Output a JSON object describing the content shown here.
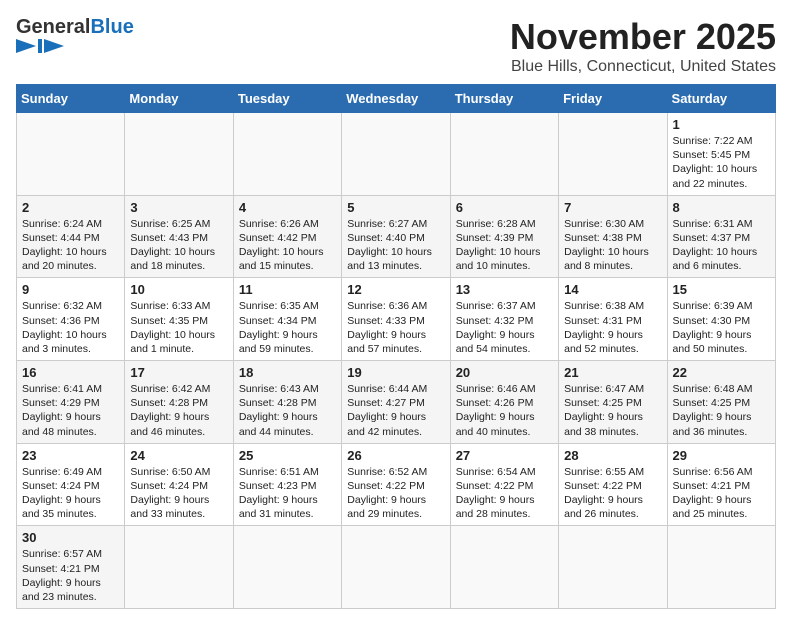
{
  "header": {
    "logo_general": "General",
    "logo_blue": "Blue",
    "month_year": "November 2025",
    "location": "Blue Hills, Connecticut, United States"
  },
  "days_of_week": [
    "Sunday",
    "Monday",
    "Tuesday",
    "Wednesday",
    "Thursday",
    "Friday",
    "Saturday"
  ],
  "weeks": [
    [
      {
        "day": "",
        "info": ""
      },
      {
        "day": "",
        "info": ""
      },
      {
        "day": "",
        "info": ""
      },
      {
        "day": "",
        "info": ""
      },
      {
        "day": "",
        "info": ""
      },
      {
        "day": "",
        "info": ""
      },
      {
        "day": "1",
        "info": "Sunrise: 7:22 AM\nSunset: 5:45 PM\nDaylight: 10 hours and 22 minutes."
      }
    ],
    [
      {
        "day": "2",
        "info": "Sunrise: 6:24 AM\nSunset: 4:44 PM\nDaylight: 10 hours and 20 minutes."
      },
      {
        "day": "3",
        "info": "Sunrise: 6:25 AM\nSunset: 4:43 PM\nDaylight: 10 hours and 18 minutes."
      },
      {
        "day": "4",
        "info": "Sunrise: 6:26 AM\nSunset: 4:42 PM\nDaylight: 10 hours and 15 minutes."
      },
      {
        "day": "5",
        "info": "Sunrise: 6:27 AM\nSunset: 4:40 PM\nDaylight: 10 hours and 13 minutes."
      },
      {
        "day": "6",
        "info": "Sunrise: 6:28 AM\nSunset: 4:39 PM\nDaylight: 10 hours and 10 minutes."
      },
      {
        "day": "7",
        "info": "Sunrise: 6:30 AM\nSunset: 4:38 PM\nDaylight: 10 hours and 8 minutes."
      },
      {
        "day": "8",
        "info": "Sunrise: 6:31 AM\nSunset: 4:37 PM\nDaylight: 10 hours and 6 minutes."
      }
    ],
    [
      {
        "day": "9",
        "info": "Sunrise: 6:32 AM\nSunset: 4:36 PM\nDaylight: 10 hours and 3 minutes."
      },
      {
        "day": "10",
        "info": "Sunrise: 6:33 AM\nSunset: 4:35 PM\nDaylight: 10 hours and 1 minute."
      },
      {
        "day": "11",
        "info": "Sunrise: 6:35 AM\nSunset: 4:34 PM\nDaylight: 9 hours and 59 minutes."
      },
      {
        "day": "12",
        "info": "Sunrise: 6:36 AM\nSunset: 4:33 PM\nDaylight: 9 hours and 57 minutes."
      },
      {
        "day": "13",
        "info": "Sunrise: 6:37 AM\nSunset: 4:32 PM\nDaylight: 9 hours and 54 minutes."
      },
      {
        "day": "14",
        "info": "Sunrise: 6:38 AM\nSunset: 4:31 PM\nDaylight: 9 hours and 52 minutes."
      },
      {
        "day": "15",
        "info": "Sunrise: 6:39 AM\nSunset: 4:30 PM\nDaylight: 9 hours and 50 minutes."
      }
    ],
    [
      {
        "day": "16",
        "info": "Sunrise: 6:41 AM\nSunset: 4:29 PM\nDaylight: 9 hours and 48 minutes."
      },
      {
        "day": "17",
        "info": "Sunrise: 6:42 AM\nSunset: 4:28 PM\nDaylight: 9 hours and 46 minutes."
      },
      {
        "day": "18",
        "info": "Sunrise: 6:43 AM\nSunset: 4:28 PM\nDaylight: 9 hours and 44 minutes."
      },
      {
        "day": "19",
        "info": "Sunrise: 6:44 AM\nSunset: 4:27 PM\nDaylight: 9 hours and 42 minutes."
      },
      {
        "day": "20",
        "info": "Sunrise: 6:46 AM\nSunset: 4:26 PM\nDaylight: 9 hours and 40 minutes."
      },
      {
        "day": "21",
        "info": "Sunrise: 6:47 AM\nSunset: 4:25 PM\nDaylight: 9 hours and 38 minutes."
      },
      {
        "day": "22",
        "info": "Sunrise: 6:48 AM\nSunset: 4:25 PM\nDaylight: 9 hours and 36 minutes."
      }
    ],
    [
      {
        "day": "23",
        "info": "Sunrise: 6:49 AM\nSunset: 4:24 PM\nDaylight: 9 hours and 35 minutes."
      },
      {
        "day": "24",
        "info": "Sunrise: 6:50 AM\nSunset: 4:24 PM\nDaylight: 9 hours and 33 minutes."
      },
      {
        "day": "25",
        "info": "Sunrise: 6:51 AM\nSunset: 4:23 PM\nDaylight: 9 hours and 31 minutes."
      },
      {
        "day": "26",
        "info": "Sunrise: 6:52 AM\nSunset: 4:22 PM\nDaylight: 9 hours and 29 minutes."
      },
      {
        "day": "27",
        "info": "Sunrise: 6:54 AM\nSunset: 4:22 PM\nDaylight: 9 hours and 28 minutes."
      },
      {
        "day": "28",
        "info": "Sunrise: 6:55 AM\nSunset: 4:22 PM\nDaylight: 9 hours and 26 minutes."
      },
      {
        "day": "29",
        "info": "Sunrise: 6:56 AM\nSunset: 4:21 PM\nDaylight: 9 hours and 25 minutes."
      }
    ],
    [
      {
        "day": "30",
        "info": "Sunrise: 6:57 AM\nSunset: 4:21 PM\nDaylight: 9 hours and 23 minutes."
      },
      {
        "day": "",
        "info": ""
      },
      {
        "day": "",
        "info": ""
      },
      {
        "day": "",
        "info": ""
      },
      {
        "day": "",
        "info": ""
      },
      {
        "day": "",
        "info": ""
      },
      {
        "day": "",
        "info": ""
      }
    ]
  ]
}
